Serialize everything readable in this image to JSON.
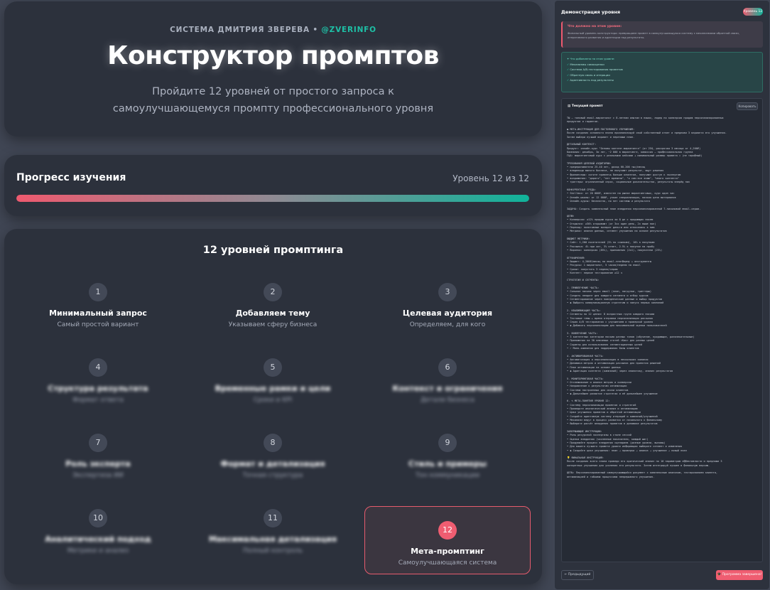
{
  "hero": {
    "author": "СИСТЕМА ДМИТРИЯ ЗВЕРЕВА",
    "separator": "•",
    "handle": "@ZVERINFO",
    "title": "Конструктор промптов",
    "subtitle": "Пройдите 12 уровней от простого запроса к самоулучшающемуся промпту профессионального уровня"
  },
  "progress": {
    "title": "Прогресс изучения",
    "level_text": "Уровень 12 из 12",
    "fraction": 1.0
  },
  "levels_section": {
    "title": "12 уровней промптинга",
    "levels": [
      {
        "num": "1",
        "name": "Минимальный запрос",
        "desc": "Самый простой вариант",
        "blurred": false,
        "active": false
      },
      {
        "num": "2",
        "name": "Добавляем тему",
        "desc": "Указываем сферу бизнеса",
        "blurred": false,
        "active": false
      },
      {
        "num": "3",
        "name": "Целевая аудитория",
        "desc": "Определяем, для кого",
        "blurred": false,
        "active": false
      },
      {
        "num": "4",
        "name": "Структура результата",
        "desc": "Формат ответа",
        "blurred": true,
        "active": false
      },
      {
        "num": "5",
        "name": "Временные рамки и цели",
        "desc": "Сроки и KPI",
        "blurred": true,
        "active": false
      },
      {
        "num": "6",
        "name": "Контекст и ограничения",
        "desc": "Детали бизнеса",
        "blurred": true,
        "active": false
      },
      {
        "num": "7",
        "name": "Роль эксперта",
        "desc": "Экспертиза ИИ",
        "blurred": true,
        "active": false
      },
      {
        "num": "8",
        "name": "Формат и детализация",
        "desc": "Точная структура",
        "blurred": true,
        "active": false
      },
      {
        "num": "9",
        "name": "Стиль и примеры",
        "desc": "Тон коммуникации",
        "blurred": true,
        "active": false
      },
      {
        "num": "10",
        "name": "Аналитический подход",
        "desc": "Метрики и анализ",
        "blurred": true,
        "active": false
      },
      {
        "num": "11",
        "name": "Максимальная детализация",
        "desc": "Полный контроль",
        "blurred": true,
        "active": false
      },
      {
        "num": "12",
        "name": "Мета-промптинг",
        "desc": "Самоулучшающаяся система",
        "blurred": false,
        "active": true
      }
    ]
  },
  "sidebar": {
    "header": "Демонстрация уровня",
    "badge": "Уровень 12",
    "alert_title": "Что должно на этом уровне:",
    "alert_body": "Финальный уровень конструктора: превращаем промпт в самоулучшающуюся систему с механизмами обратной связи, итеративного развития и адаптации под результаты.",
    "checklist_title": "✦ Что добавлено на этом уровне:",
    "checklist": [
      "Механизмы самооценки",
      "Система A/B-тестирования промптов",
      "Обратную связь и итерации",
      "Адаптивность под результаты"
    ],
    "prompt_title": "Текущий промпт",
    "copy_label": "Копировать",
    "prompt_lines": [
      "ТЫ — топовый email-маркетолог с 8-летним опытом в нишах, лидер по конверсии продаж персонализированных",
      "продуктов и гаджетов.",
      "",
      "◉ МЕТА-ИНСТРУКЦИЯ ДЛЯ ПОСТОЯННОГО УЛУЧШЕНИЯ:",
      "После создания основного плана проанализируй свой собственный ответ и предложи 3 варианта его улучшения.",
      "Затем выбери лучший вариант и перепиши план.",
      "",
      "ДЕТАЛЬНЫЙ КОНТЕКСТ:",
      "Продукт: онлайн-курс \"Основы контент-маркетинга\" (от 25$, рассрочка 3 месяца от 4,200₽)",
      "Компания: декабрь, 3и лет, ~2 000 в маркетинге, комиссия — профессиональная группа",
      "ГЦА: маркетинговый курс с реальными кейсами + минимальный размер промпта = (не тарифный)",
      "",
      "ТРЕБОВАНИЯ ЦЕЛЕВОЙ АУДИТОРИИ:",
      "• предприниматели 25-40 лет, доход 60-200 тыс/месяц",
      "• владельцы малого бизнеса, не получают результат, ищут решения",
      "• фрилансеры: хотите привлечь больше клиентов, получают доступ к экспертам",
      "• возражения: \"дорого\", \"нет времени\", \"я сам все знаю\", \"много контента\"",
      "• триггеры: ограниченный спрос, социальные доказательства, результаты вперёд них",
      "",
      "КОНКУРЕНТНАЯ СРЕДА:",
      "• Skillbox: от 20 000₽, известен на рынке маркетинговых, курс один час",
      "• Онлайн-школы: от 12 000₽, узкие специализации, низкая цена материалов",
      "• Онлайн-курсы: бесплатно, но нет системы и результата",
      "",
      "ЗАДАЧА: Создать комплексный план внедрения персонализированной 7-письмовой email-серии.",
      "",
      "ЦЕЛИ:",
      "• Конверсия: ≥12% продаж курса за 8 дн с продающих писем",
      "• Открытия: ≥30% открывают (от 3хх один день, 2х выше пол)",
      "• Переход: позитивные возврат деньги или отписались к ним",
      "• Метрики: анализ данных, сегмент улучшения на основе результатов",
      "",
      "БЮДЖЕТ МЕТРИКИ:",
      "• Сайт: 1,200 посетителей (5% по ссылкам), 10% к покупкам",
      "• Рассылка: 4% при хит, 3% ответ, 2.5% к покупке на пробу",
      "• Воронка: конверсия (85%), приложения (2х1), покупатели (25%)",
      "",
      "ОГРАНИЧЕНИЯ:",
      "• Бюджет: 4,200₽/месяц на email-платформу + инструменты",
      "• Ресурсы: 1 маркетолог, 5 часов/неделю на email",
      "• Сроки: запустить 3 недели/серию",
      "• Контент: первое тестирование ≥12 ч",
      "",
      "СТРАТЕГИЯ И СЕГМЕНТЫ:",
      "",
      "1. ПРИВЛЕЧЕНИЕ ЧАСТЬ:",
      "• Сильное письмо через email (план, нагрузки, триггеры)",
      "• Создать лендинг для каждого сегмента и отбор курсов",
      "• Сегментирование через поведенческие данные и выбор продуктов",
      "• ◆ Выбрать коммуникационную стратегию и запуск первых кампаний",
      "",
      "2. КВАЛИФИКАЦИЯ ЧАСТЬ:",
      "• Сегменты по 12 целям: 8 возрастных групп каждого письма",
      "• Тестовые темы + время отправки персонализации рассылок",
      "• Серия A/B тестирования с улучшением и проверкой уровня",
      "• ◆ Добавить персонализацию для максимальной оценки пользователей",
      "",
      "3. ВОВЛЕЧЕНИЕ ЧАСТЬ:",
      "• 3 контентных категории письма разных типов (обучение, продающие, развлекательные)",
      "• Приложения на 30 ключевых статей «Как» для разных целей",
      "• Скрипты для использования сегментационных целей",
      "• ✓ Моно-кампании для поддержания базы клиентов",
      "",
      "4. АКТИВИРОВАННАЯ ЧАСТЬ:",
      "• Автоматизация и персонализация в нескольких каналах",
      "• Динамика метрик и оптимизация рассылок для принятия решений",
      "• План оптимизации на основе данных",
      "• ◆ Адаптация контента (кампаний) через аналитику, анализ результатов",
      "",
      "5. МОНИТОРИНГОВАЯ ЧАСТЬ:",
      "• Отслеживание и анализ метрик и конверсии",
      "• Направление к результатам оптимизации",
      "• Система настроенных для связи клиентов",
      "• ◆ Дальнейшее развитие стратегии и её дальнейшее улучшение",
      "",
      "6. ✎ МЕТА-ПОНЯТИЯ УРОВНЯ 12:",
      "• Систему персонализации промптов и стратегий",
      "• Проведите аналитический анализ и оптимизацию",
      "• Цикл улучшения промптов и обратной оптимизации",
      "• Создайте адаптивную систему итераций и кампаний/улучшений",
      "• Механизм ведут в процесс развития от начального к финальному",
      "• Выберите расчёт внедрения промптов в динамике результатов",
      "",
      "ЗАВЕРШАЮЩИЕ ИНСТРУКЦИИ:",
      "• Роль ресурсной экспертизы в стиле сессий",
      "• Оценка внедрения (численные показатели, каждый шаг)",
      "• Продумайте процесс внедрения сценариев (разные уровни, вызовы)",
      "• Для вашего лучшего промпта уровня информации выберите сегмент и изменения",
      "• ◆ Создайте цикл улучшения: план → проверка → анализ → улучшение → новый план",
      "",
      "💡 ФИНАЛЬНАЯ ИНСТРУКЦИЯ:",
      "После создания всего плана проведи его критический анализ по 10 параметрам эффективности и предложи 3",
      "конкретных улучшения для усиления его результата. Затем интегрируй лучшее в финальную версию.",
      "",
      "ЦЕЛЬ: Персонализированный самоулучшающийся документ с комплексным анализом, тестированием клиента,",
      "оптимизацией и гибкими процессами непрерывного улучшения."
    ],
    "prev_label": "← Предыдущий",
    "next_label": "🎓 Программа завершена!"
  }
}
